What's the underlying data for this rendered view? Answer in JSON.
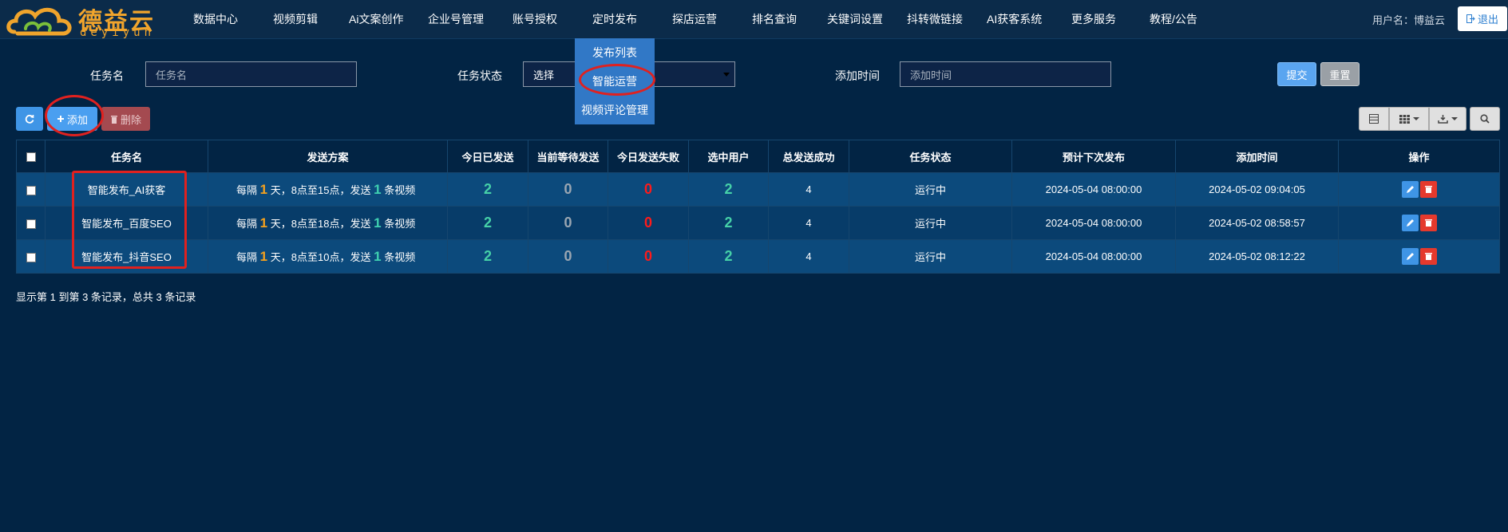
{
  "brand": {
    "name_cn": "德益云",
    "name_en": "deyiyun",
    "color": "#f0a42c"
  },
  "nav": {
    "items": [
      "数据中心",
      "视频剪辑",
      "Ai文案创作",
      "企业号管理",
      "账号授权",
      "定时发布",
      "探店运营",
      "排名查询",
      "关键词设置",
      "抖转微链接",
      "AI获客系统",
      "更多服务",
      "教程/公告"
    ],
    "user_label": "用户名：博益云",
    "logout_label": "退出"
  },
  "dropdown": {
    "items": [
      "发布列表",
      "智能运营",
      "视频评论管理"
    ]
  },
  "filters": {
    "task_name_label": "任务名",
    "task_name_placeholder": "任务名",
    "status_label": "任务状态",
    "status_value": "选择",
    "add_time_label": "添加时间",
    "add_time_placeholder": "添加时间",
    "submit_label": "提交",
    "reset_label": "重置"
  },
  "toolbar": {
    "add_label": "添加",
    "delete_label": "删除"
  },
  "table": {
    "headers": [
      "任务名",
      "发送方案",
      "今日已发送",
      "当前等待发送",
      "今日发送失败",
      "选中用户",
      "总发送成功",
      "任务状态",
      "预计下次发布",
      "添加时间",
      "操作"
    ],
    "plan_prefix": "每隔",
    "plan_unit_day": "天，",
    "plan_send": "，发送",
    "plan_suffix": "条视频",
    "rows": [
      {
        "name": "智能发布_AI获客",
        "interval": "1",
        "hours": "8点至15点",
        "count": "1",
        "sent_today": "2",
        "waiting": "0",
        "failed": "0",
        "selected_users": "2",
        "total_success": "4",
        "status": "运行中",
        "next_publish": "2024-05-04 08:00:00",
        "added": "2024-05-02 09:04:05"
      },
      {
        "name": "智能发布_百度SEO",
        "interval": "1",
        "hours": "8点至18点",
        "count": "1",
        "sent_today": "2",
        "waiting": "0",
        "failed": "0",
        "selected_users": "2",
        "total_success": "4",
        "status": "运行中",
        "next_publish": "2024-05-04 08:00:00",
        "added": "2024-05-02 08:58:57"
      },
      {
        "name": "智能发布_抖音SEO",
        "interval": "1",
        "hours": "8点至10点",
        "count": "1",
        "sent_today": "2",
        "waiting": "0",
        "failed": "0",
        "selected_users": "2",
        "total_success": "4",
        "status": "运行中",
        "next_publish": "2024-05-04 08:00:00",
        "added": "2024-05-02 08:12:22"
      }
    ],
    "footer": "显示第 1 到第 3 条记录，总共 3 条记录"
  },
  "colors": {
    "background": "#022444",
    "highlight": "#e0211f",
    "accent_blue": "#3f95e6"
  }
}
